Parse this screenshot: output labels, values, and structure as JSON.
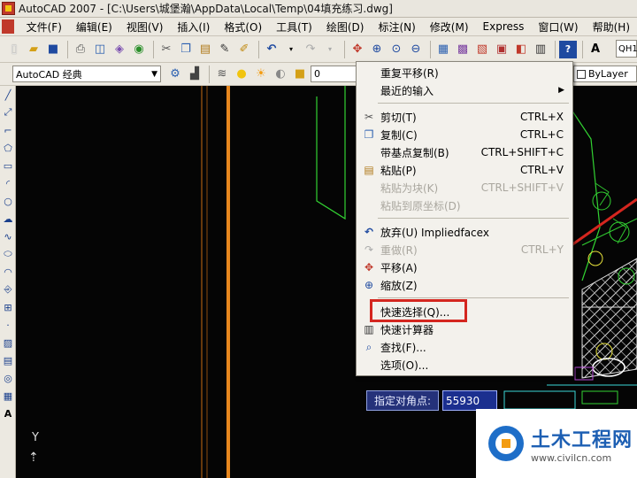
{
  "window": {
    "title": "AutoCAD 2007 - [C:\\Users\\城堡瀚\\AppData\\Local\\Temp\\04填充练习.dwg]"
  },
  "menubar": {
    "items": [
      {
        "label": "文件(F)"
      },
      {
        "label": "编辑(E)"
      },
      {
        "label": "视图(V)"
      },
      {
        "label": "插入(I)"
      },
      {
        "label": "格式(O)"
      },
      {
        "label": "工具(T)"
      },
      {
        "label": "绘图(D)"
      },
      {
        "label": "标注(N)"
      },
      {
        "label": "修改(M)"
      },
      {
        "label": "Express"
      },
      {
        "label": "窗口(W)"
      },
      {
        "label": "帮助(H)"
      }
    ]
  },
  "toolbar": {
    "workspace_value": "AutoCAD 经典",
    "layer_value": "0",
    "color_value": "ByLayer",
    "text_style_value": "QH1"
  },
  "context_menu": {
    "items": [
      {
        "label": "重复平移(R)",
        "shortcut": "",
        "icon": "",
        "enabled": true
      },
      {
        "label": "最近的输入",
        "shortcut": "",
        "icon": "",
        "enabled": true,
        "submenu": true
      },
      {
        "label": "剪切(T)",
        "shortcut": "CTRL+X",
        "icon": "scissors-icon",
        "enabled": true
      },
      {
        "label": "复制(C)",
        "shortcut": "CTRL+C",
        "icon": "copy-icon",
        "enabled": true
      },
      {
        "label": "带基点复制(B)",
        "shortcut": "CTRL+SHIFT+C",
        "icon": "",
        "enabled": true
      },
      {
        "label": "粘贴(P)",
        "shortcut": "CTRL+V",
        "icon": "paste-icon",
        "enabled": true
      },
      {
        "label": "粘贴为块(K)",
        "shortcut": "CTRL+SHIFT+V",
        "icon": "",
        "enabled": false
      },
      {
        "label": "粘贴到原坐标(D)",
        "shortcut": "",
        "icon": "",
        "enabled": false
      },
      {
        "label": "放弃(U) Impliedfacex",
        "shortcut": "",
        "icon": "undo-icon",
        "enabled": true
      },
      {
        "label": "重做(R)",
        "shortcut": "CTRL+Y",
        "icon": "redo-icon",
        "enabled": false
      },
      {
        "label": "平移(A)",
        "shortcut": "",
        "icon": "pan-icon",
        "enabled": true
      },
      {
        "label": "缩放(Z)",
        "shortcut": "",
        "icon": "zoom-icon",
        "enabled": true
      },
      {
        "label": "快速选择(Q)...",
        "shortcut": "",
        "icon": "",
        "enabled": true
      },
      {
        "label": "快速计算器",
        "shortcut": "",
        "icon": "calculator-icon",
        "enabled": true
      },
      {
        "label": "查找(F)...",
        "shortcut": "",
        "icon": "find-icon",
        "enabled": true
      },
      {
        "label": "选项(O)...",
        "shortcut": "",
        "icon": "",
        "enabled": true
      }
    ]
  },
  "dynamic_input": {
    "prompt": "指定对角点:",
    "value": "55930"
  },
  "ucs": {
    "y_label": "Y"
  },
  "watermark": {
    "main": "土木工程网",
    "sub": "www.civilcn.com"
  },
  "colors": {
    "canvas": "#050505",
    "highlight": "#d4261f",
    "drawing_green": "#32d232",
    "column_orange": "#e8871e"
  }
}
